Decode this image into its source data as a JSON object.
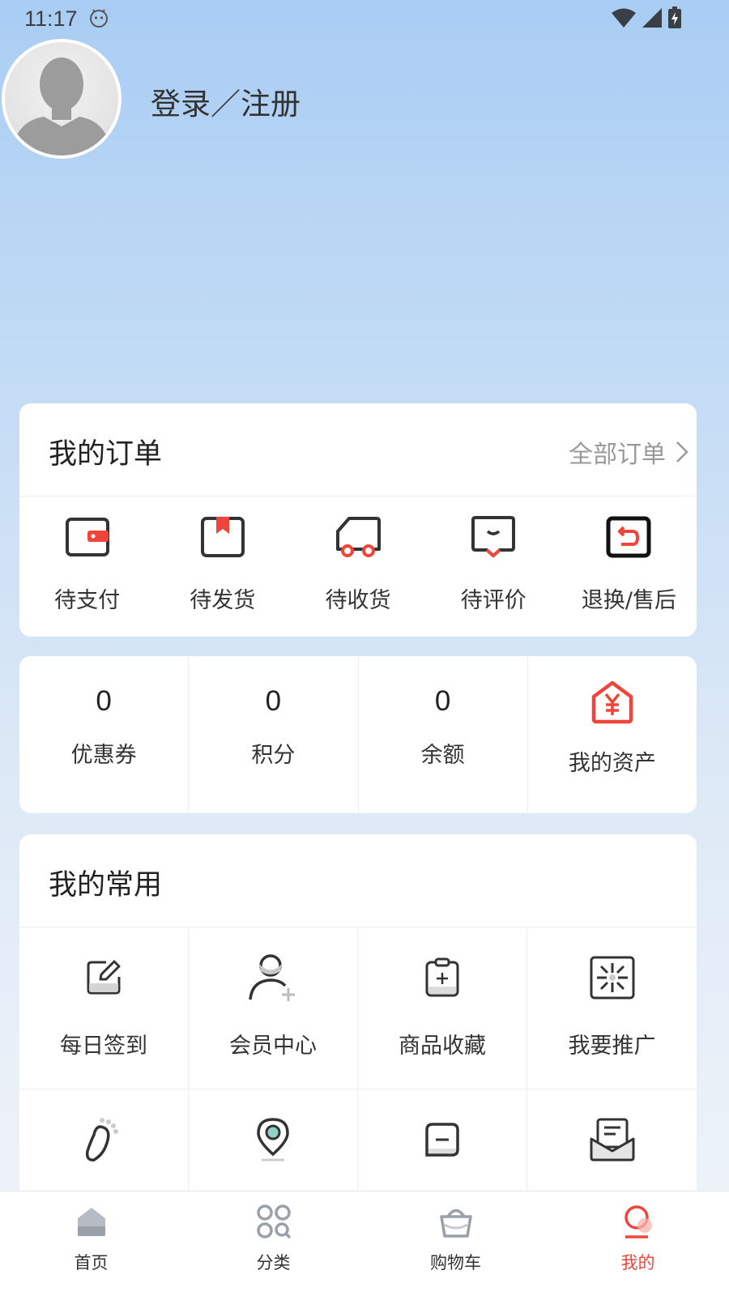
{
  "status": {
    "time": "11:17"
  },
  "profile": {
    "login_label": "登录／注册"
  },
  "orders": {
    "title": "我的订单",
    "all_label": "全部订单",
    "items": [
      {
        "label": "待支付",
        "icon": "wallet-icon"
      },
      {
        "label": "待发货",
        "icon": "package-icon"
      },
      {
        "label": "待收货",
        "icon": "truck-icon"
      },
      {
        "label": "待评价",
        "icon": "comment-icon"
      },
      {
        "label": "退换/售后",
        "icon": "return-icon"
      }
    ]
  },
  "assets": {
    "items": [
      {
        "value": "0",
        "label": "优惠券"
      },
      {
        "value": "0",
        "label": "积分"
      },
      {
        "value": "0",
        "label": "余额"
      }
    ],
    "my_assets_label": "我的资产"
  },
  "common": {
    "title": "我的常用",
    "items": [
      {
        "label": "每日签到",
        "icon": "edit-icon"
      },
      {
        "label": "会员中心",
        "icon": "user-add-icon"
      },
      {
        "label": "商品收藏",
        "icon": "clipboard-add-icon"
      },
      {
        "label": "我要推广",
        "icon": "expand-icon"
      },
      {
        "label": "",
        "icon": "footprint-icon"
      },
      {
        "label": "",
        "icon": "location-icon"
      },
      {
        "label": "",
        "icon": "chat-icon"
      },
      {
        "label": "",
        "icon": "mail-icon"
      }
    ]
  },
  "tabbar": {
    "items": [
      {
        "label": "首页",
        "icon": "home-icon"
      },
      {
        "label": "分类",
        "icon": "category-icon"
      },
      {
        "label": "购物车",
        "icon": "basket-icon"
      },
      {
        "label": "我的",
        "icon": "profile-icon"
      }
    ],
    "active_index": 3,
    "active_color": "#f0453a"
  },
  "colors": {
    "accent": "#f0453a",
    "icon_dark": "#333333"
  }
}
